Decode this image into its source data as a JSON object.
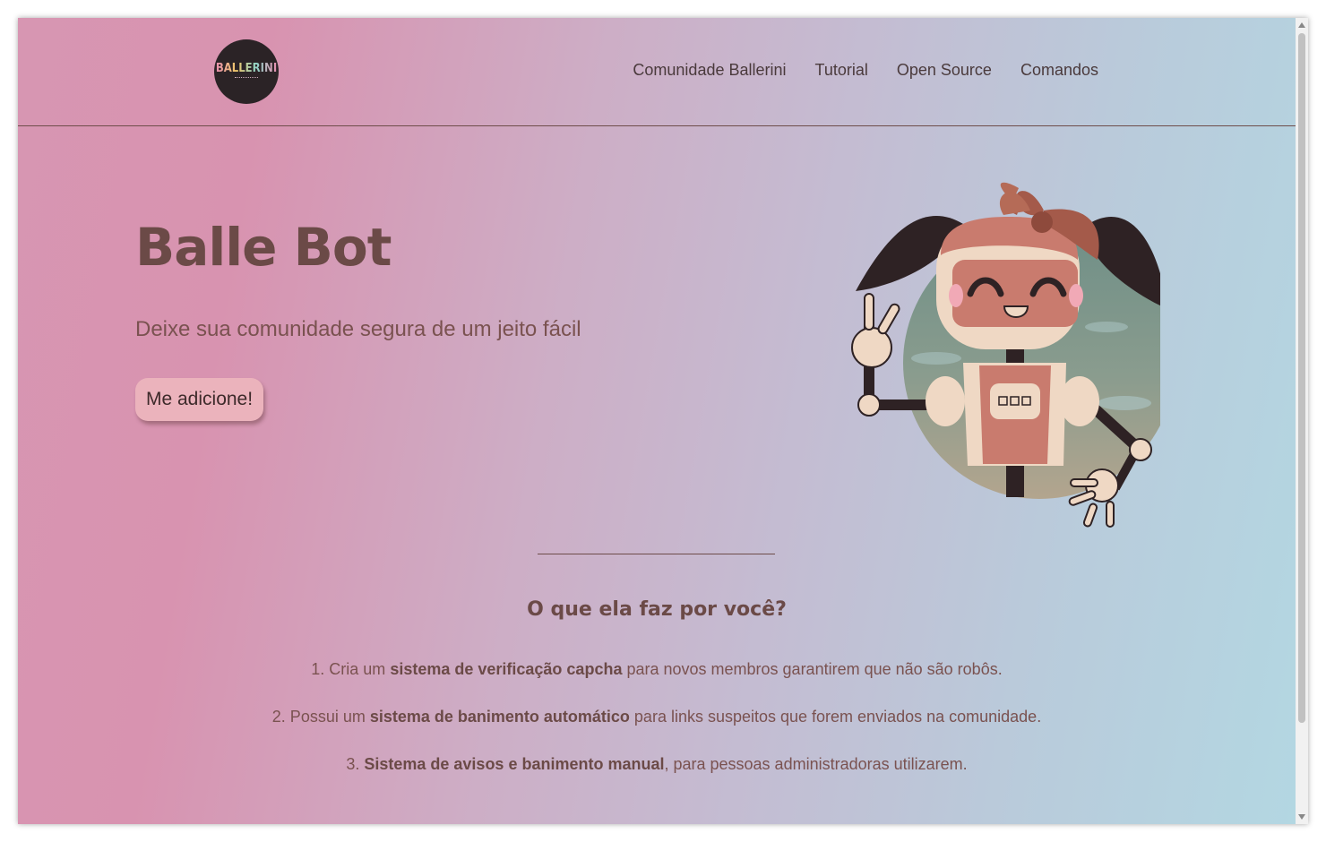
{
  "header": {
    "logo_text": "BALLERINI",
    "nav": [
      {
        "label": "Comunidade Ballerini"
      },
      {
        "label": "Tutorial"
      },
      {
        "label": "Open Source"
      },
      {
        "label": "Comandos"
      }
    ]
  },
  "hero": {
    "title": "Balle Bot",
    "subtitle": "Deixe sua comunidade segura de um jeito fácil",
    "cta_label": "Me adicione!",
    "illustration": "robot-mascot"
  },
  "features": {
    "title": "O que ela faz por você?",
    "items": [
      {
        "prefix": "1. Cria um ",
        "bold": "sistema de verificação capcha",
        "suffix": " para novos membros garantirem que não são robôs."
      },
      {
        "prefix": "2. Possui um ",
        "bold": "sistema de banimento automático",
        "suffix": " para links suspeitos que forem enviados na comunidade."
      },
      {
        "prefix": "3. ",
        "bold": "Sistema de avisos e banimento manual",
        "suffix": ", para pessoas administradoras utilizarem."
      }
    ]
  },
  "colors": {
    "gradient_left": "#d893b0",
    "gradient_right": "#b3d7e2",
    "text_primary": "#6b4a47",
    "button_bg": "#ebb3bc"
  }
}
